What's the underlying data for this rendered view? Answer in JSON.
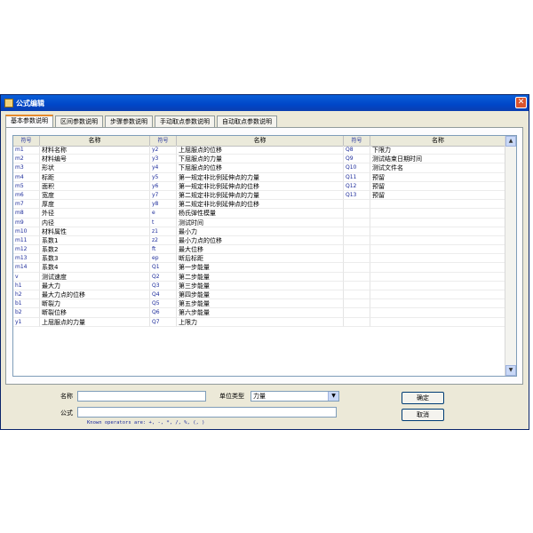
{
  "window": {
    "title": "公式编辑",
    "close_glyph": "✕"
  },
  "tabs": [
    {
      "label": "基本参数说明"
    },
    {
      "label": "区间参数说明"
    },
    {
      "label": "步骤参数说明"
    },
    {
      "label": "手动取点参数说明"
    },
    {
      "label": "自动取点参数说明"
    }
  ],
  "table": {
    "headers": [
      "符号",
      "名称",
      "符号",
      "名称",
      "符号",
      "名称"
    ],
    "rows": [
      [
        "m1",
        "材料名称",
        "y2",
        "上屈服点的位移",
        "Q8",
        "下限力"
      ],
      [
        "m2",
        "材料编号",
        "y3",
        "下屈服点的力量",
        "Q9",
        "测试结束日期时间"
      ],
      [
        "m3",
        "形状",
        "y4",
        "下屈服点的位移",
        "Q10",
        "测试文件名"
      ],
      [
        "m4",
        "标距",
        "y5",
        "第一规定非比例延伸点的力量",
        "Q11",
        "预留"
      ],
      [
        "m5",
        "面积",
        "y6",
        "第一规定非比例延伸点的位移",
        "Q12",
        "预留"
      ],
      [
        "m6",
        "宽度",
        "y7",
        "第二规定非比例延伸点的力量",
        "Q13",
        "预留"
      ],
      [
        "m7",
        "厚度",
        "y8",
        "第二规定非比例延伸点的位移",
        "",
        ""
      ],
      [
        "m8",
        "外径",
        "e",
        "杨氏弹性模量",
        "",
        ""
      ],
      [
        "m9",
        "内径",
        "t",
        "测试时间",
        "",
        ""
      ],
      [
        "m10",
        "材料属性",
        "z1",
        "最小力",
        "",
        ""
      ],
      [
        "m11",
        "系数1",
        "z2",
        "最小力点的位移",
        "",
        ""
      ],
      [
        "m12",
        "系数2",
        "ft",
        "最大位移",
        "",
        ""
      ],
      [
        "m13",
        "系数3",
        "ep",
        "断后标距",
        "",
        ""
      ],
      [
        "m14",
        "系数4",
        "Q1",
        "第一步能量",
        "",
        ""
      ],
      [
        "v",
        "测试速度",
        "Q2",
        "第二步能量",
        "",
        ""
      ],
      [
        "h1",
        "最大力",
        "Q3",
        "第三步能量",
        "",
        ""
      ],
      [
        "h2",
        "最大力点的位移",
        "Q4",
        "第四步能量",
        "",
        ""
      ],
      [
        "b1",
        "断裂力",
        "Q5",
        "第五步能量",
        "",
        ""
      ],
      [
        "b2",
        "断裂位移",
        "Q6",
        "第六步能量",
        "",
        ""
      ],
      [
        "y1",
        "上屈服点的力量",
        "Q7",
        "上限力",
        "",
        ""
      ]
    ]
  },
  "scrollbar": {
    "up_glyph": "▲",
    "down_glyph": "▼"
  },
  "form": {
    "name_label": "名称",
    "name_value": "",
    "unit_label": "单位类型",
    "unit_value": "力量",
    "unit_arrow": "▼",
    "formula_label": "公式",
    "formula_value": "",
    "hint": "Known operators are: +, -, *, /, %, (, )",
    "ok_label": "确定",
    "cancel_label": "取消"
  }
}
